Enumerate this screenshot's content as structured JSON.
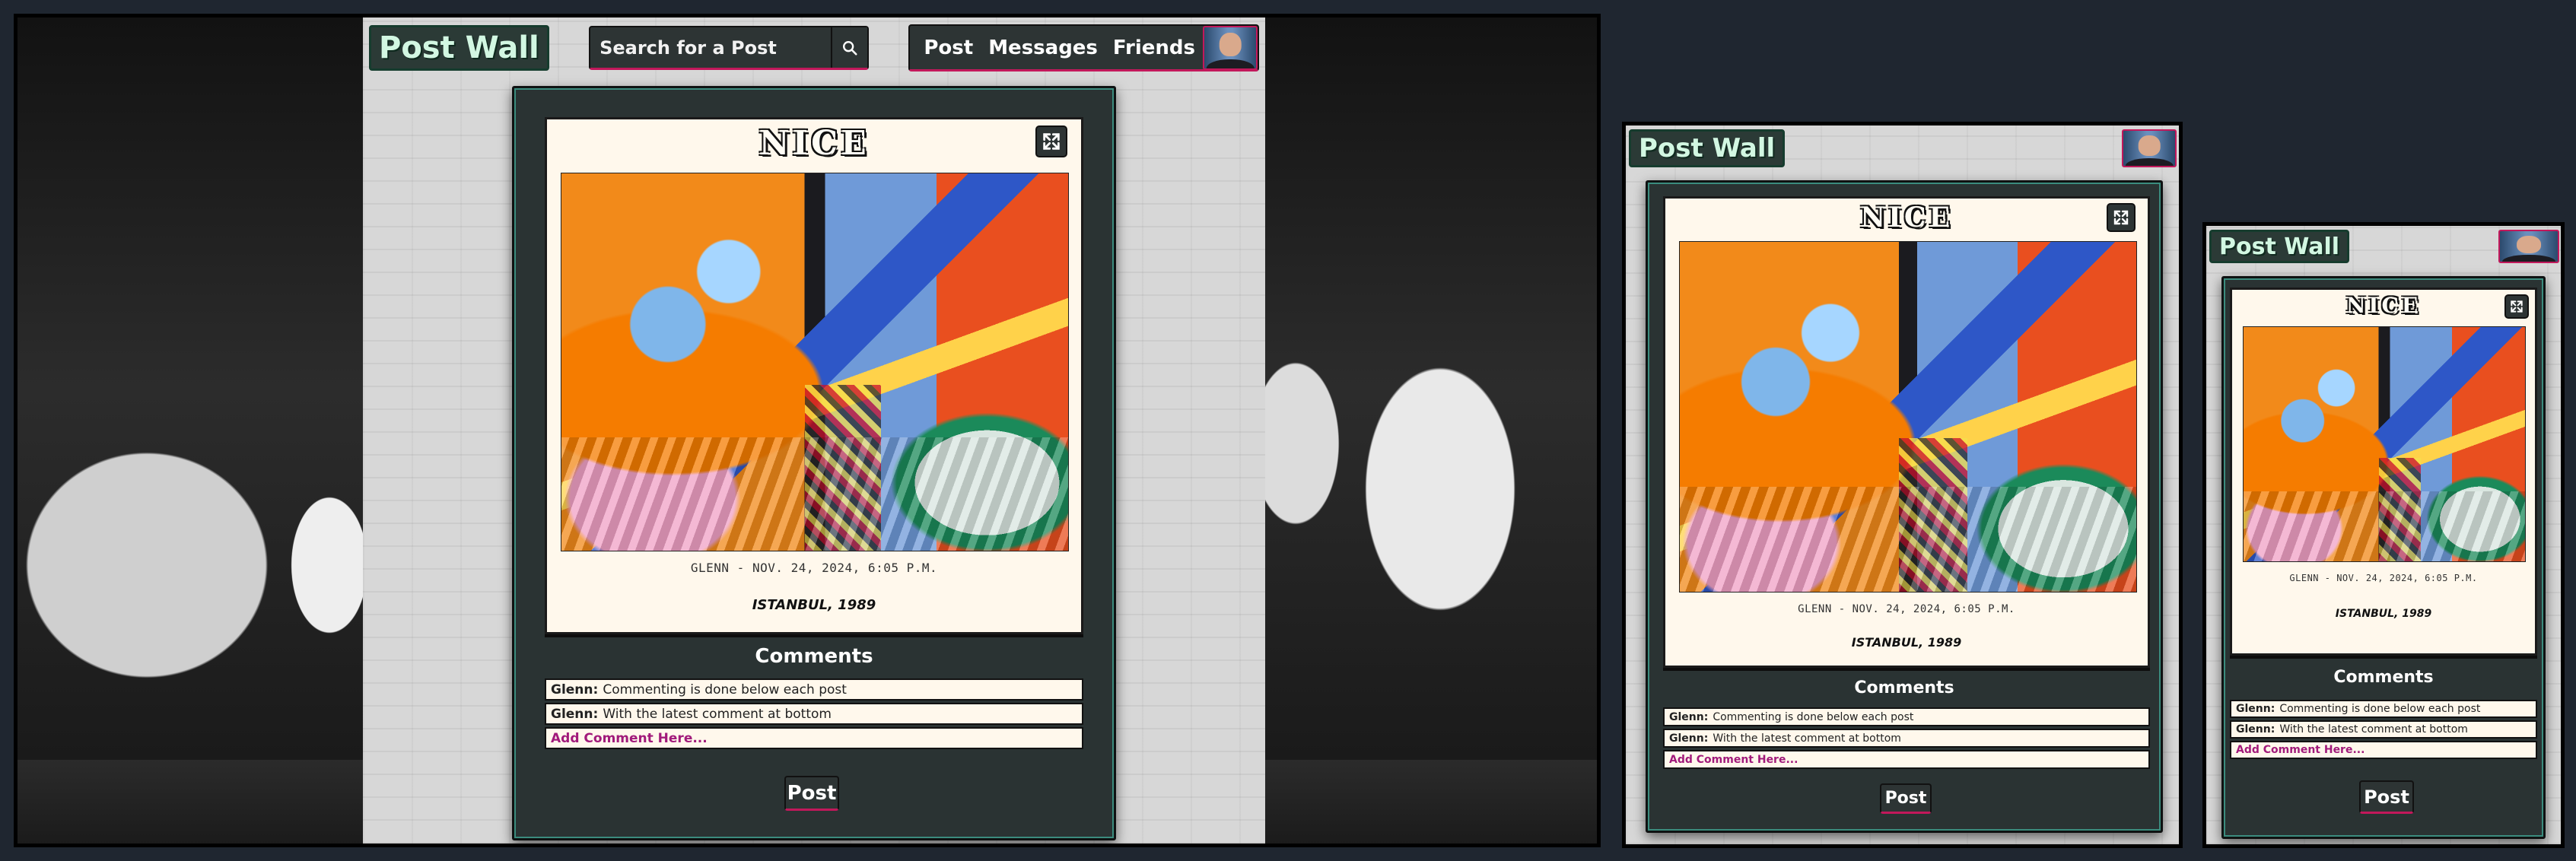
{
  "nav": {
    "logo": "Post Wall",
    "search_placeholder": "Search for a Post",
    "links": [
      "Post",
      "Messages",
      "Friends"
    ]
  },
  "post": {
    "title": "NICE",
    "meta": "GLENN - NOV. 24, 2024, 6:05 P.M.",
    "caption": "ISTANBUL, 1989"
  },
  "comments": {
    "heading": "Comments",
    "items": [
      {
        "author": "Glenn:",
        "text": "Commenting is done below each post"
      },
      {
        "author": "Glenn:",
        "text": "With the latest comment at bottom"
      }
    ],
    "add_label": "Add Comment Here...",
    "post_button": "Post"
  },
  "colors": {
    "page_background": "#1f2630",
    "accent": "#c2185b",
    "card": "#2a3333",
    "post_paper": "#fff8ec",
    "logo_text": "#d2f7e2",
    "add_comment": "#a11a7b"
  },
  "icons": {
    "search": "search-icon",
    "expand": "expand-icon",
    "avatar": "avatar"
  }
}
